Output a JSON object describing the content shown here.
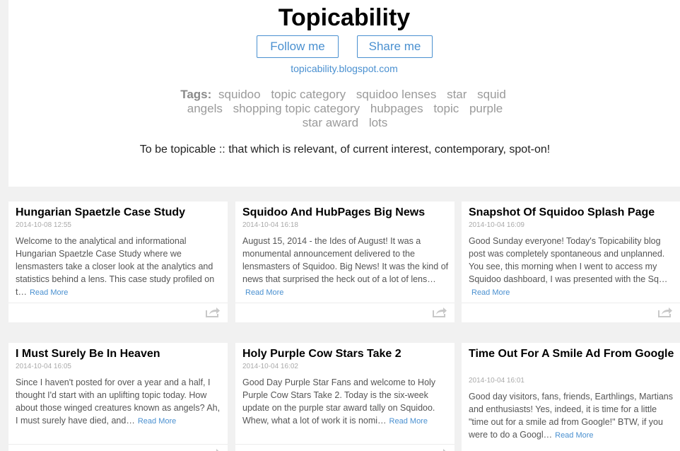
{
  "header": {
    "title": "Topicability",
    "follow_label": "Follow me",
    "share_label": "Share me",
    "blog_url": "topicability.blogspot.com",
    "tags_label": "Tags:",
    "tags": [
      "squidoo",
      "topic category",
      "squidoo lenses",
      "star",
      "squid",
      "angels",
      "shopping topic category",
      "hubpages",
      "topic",
      "purple",
      "star award",
      "lots"
    ],
    "tagline": "To be topicable :: that which is relevant, of current interest, contemporary, spot-on!"
  },
  "posts": [
    {
      "title": "Hungarian Spaetzle Case Study",
      "date": "2014-10-08 12:55",
      "excerpt": "Welcome to the analytical and informational Hungarian Spaetzle Case Study where we lensmasters take a closer look at the analytics and statistics behind a lens. This case study profiled on t…",
      "read_more": "Read More"
    },
    {
      "title": "Squidoo And HubPages Big News",
      "date": "2014-10-04 16:18",
      "excerpt": "August 15, 2014 - the Ides of August! It was a monumental announcement delivered to the lensmasters of Squidoo. Big News! It was the kind of news that surprised the heck out of a lot of lens…",
      "read_more": "Read More"
    },
    {
      "title": "Snapshot Of Squidoo Splash Page",
      "date": "2014-10-04 16:09",
      "excerpt": "Good Sunday everyone! Today's Topicability blog post was completely spontaneous and unplanned. You see, this morning when I went to access my Squidoo dashboard, I was presented with the Sq…",
      "read_more": "Read More"
    },
    {
      "title": "I Must Surely Be In Heaven",
      "date": "2014-10-04 16:05",
      "excerpt": "Since I haven't posted for over a year and a half, I thought I'd start with an uplifting topic today.  How about those winged creatures known as angels? Ah, I must surely have died, and…",
      "read_more": "Read More"
    },
    {
      "title": "Holy Purple Cow Stars Take 2",
      "date": "2014-10-04 16:02",
      "excerpt": "Good Day Purple Star Fans and welcome to Holy Purple Cow Stars Take 2.  Today is the six-week update on the purple star award tally on Squidoo. Whew, what a lot of work it is nomi…",
      "read_more": "Read More"
    },
    {
      "title": "Time Out For A Smile Ad From Google",
      "date": "2014-10-04 16:01",
      "excerpt": "Good day visitors, fans, friends, Earthlings, Martians and enthusiasts!  Yes, indeed, it is time for a little \"time out for a smile ad from Google!\" BTW, if you were to do a Googl…",
      "read_more": "Read More"
    }
  ]
}
